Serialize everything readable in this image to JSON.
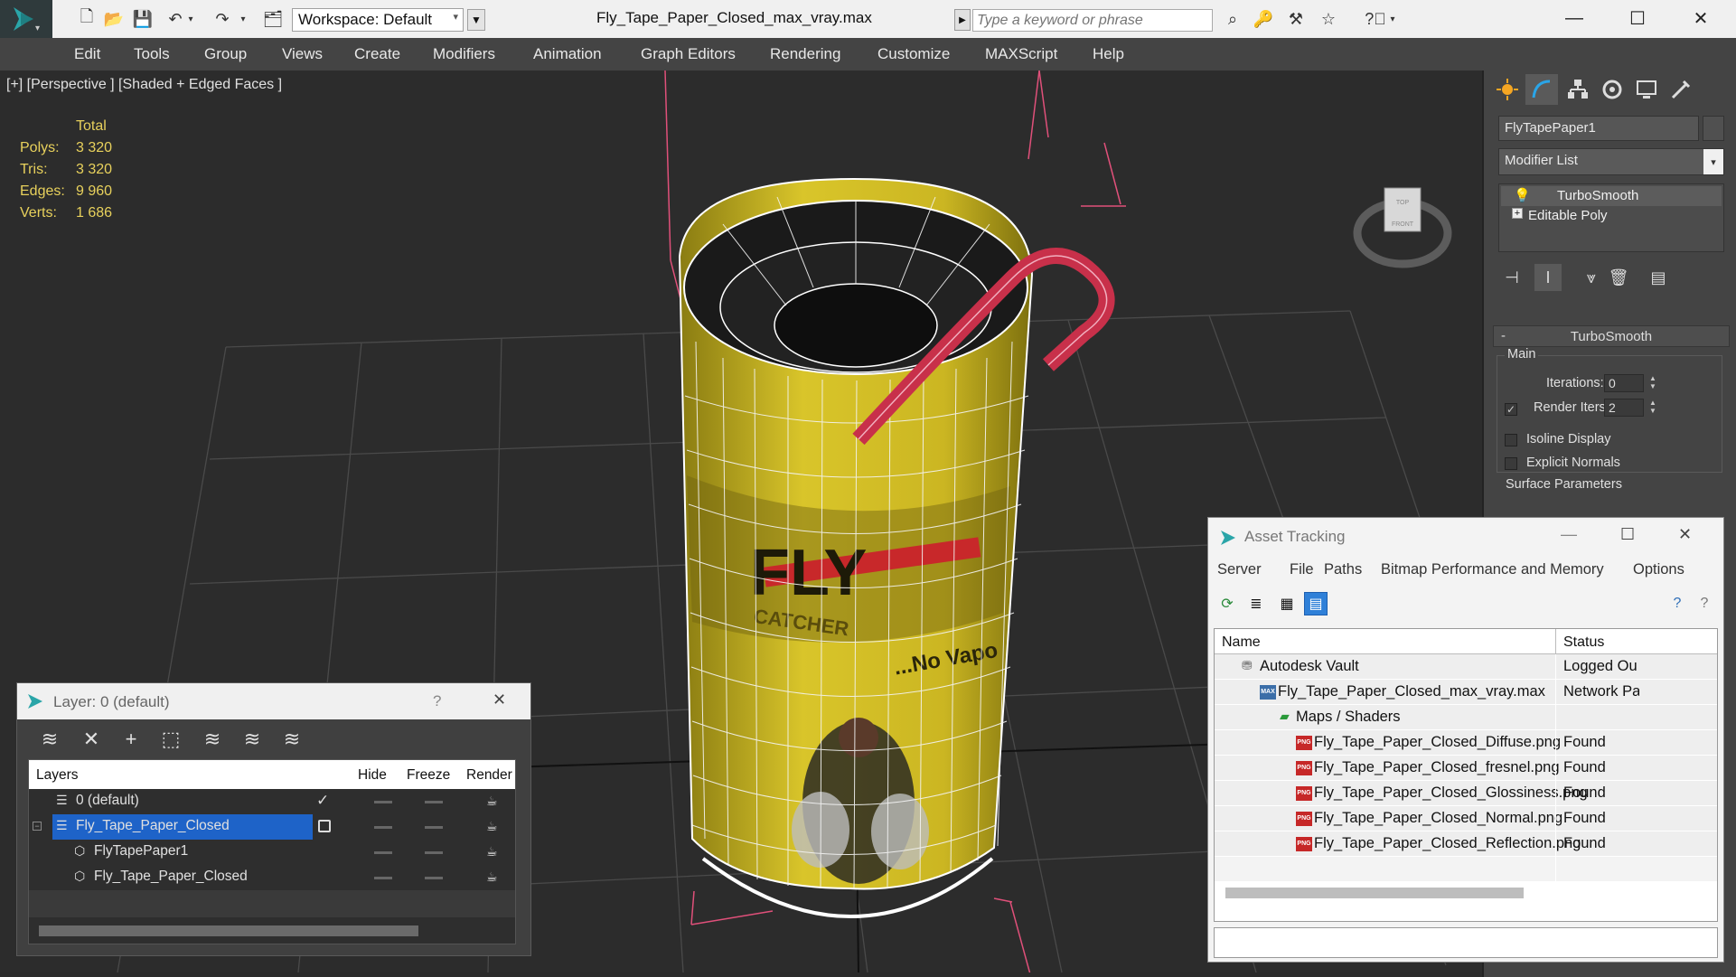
{
  "titlebar": {
    "workspace": "Workspace: Default",
    "document_title": "Fly_Tape_Paper_Closed_max_vray.max",
    "search_placeholder": "Type a keyword or phrase"
  },
  "menubar": [
    "Edit",
    "Tools",
    "Group",
    "Views",
    "Create",
    "Modifiers",
    "Animation",
    "Graph Editors",
    "Rendering",
    "Customize",
    "MAXScript",
    "Help"
  ],
  "viewport": {
    "label": "[+] [Perspective ] [Shaded + Edged Faces ]",
    "stats_header": "Total",
    "stats": [
      {
        "label": "Polys:",
        "value": "3 320"
      },
      {
        "label": "Tris:",
        "value": "3 320"
      },
      {
        "label": "Edges:",
        "value": "9 960"
      },
      {
        "label": "Verts:",
        "value": "1 686"
      }
    ],
    "model_text": {
      "fly": "FLY",
      "catcher": "CATCHER",
      "tagline": "...No Vapo"
    },
    "viewcube": {
      "top": "TOP",
      "front": "FRONT"
    }
  },
  "command_panel": {
    "object_name": "FlyTapePaper1",
    "modifier_list": "Modifier List",
    "stack": [
      "TurboSmooth",
      "Editable Poly"
    ],
    "rollout": {
      "title": "TurboSmooth",
      "group": "Main",
      "iterations_label": "Iterations:",
      "iterations_value": "0",
      "render_iters_label": "Render Iters:",
      "render_iters_value": "2",
      "isoline_label": "Isoline Display",
      "explicit_normals_label": "Explicit Normals",
      "surface_params_label": "Surface Parameters"
    }
  },
  "asset_tracking": {
    "title": "Asset Tracking",
    "menu": [
      "Server",
      "File",
      "Paths",
      "Bitmap Performance and Memory",
      "Options"
    ],
    "columns": [
      "Name",
      "Status"
    ],
    "rows": [
      {
        "name": "Autodesk Vault",
        "status": "Logged Ou",
        "icon": "vault-icon"
      },
      {
        "name": "Fly_Tape_Paper_Closed_max_vray.max",
        "status": "Network Pa",
        "icon": "max-file-icon"
      },
      {
        "name": "Maps / Shaders",
        "status": "",
        "icon": "maps-icon"
      },
      {
        "name": "Fly_Tape_Paper_Closed_Diffuse.png",
        "status": "Found",
        "icon": "png-icon"
      },
      {
        "name": "Fly_Tape_Paper_Closed_fresnel.png",
        "status": "Found",
        "icon": "png-icon"
      },
      {
        "name": "Fly_Tape_Paper_Closed_Glossiness.png",
        "status": "Found",
        "icon": "png-icon"
      },
      {
        "name": "Fly_Tape_Paper_Closed_Normal.png",
        "status": "Found",
        "icon": "png-icon"
      },
      {
        "name": "Fly_Tape_Paper_Closed_Reflection.png",
        "status": "Found",
        "icon": "png-icon"
      }
    ],
    "png_badge": "PNG",
    "max_badge": "MAX"
  },
  "layer_dialog": {
    "title": "Layer: 0 (default)",
    "help": "?",
    "columns": [
      "Layers",
      "Hide",
      "Freeze",
      "Render"
    ],
    "rows": [
      {
        "name": "0 (default)",
        "selected": false
      },
      {
        "name": "Fly_Tape_Paper_Closed",
        "selected": true
      },
      {
        "name": "FlyTapePaper1",
        "selected": false
      },
      {
        "name": "Fly_Tape_Paper_Closed",
        "selected": false
      }
    ]
  },
  "colors": {
    "accent_selection": "#1e63c8",
    "stats_yellow": "#e8d15c",
    "can_yellow": "#d9c52a",
    "handle_red": "#c8304a",
    "bbox_pink": "#e0507a"
  }
}
